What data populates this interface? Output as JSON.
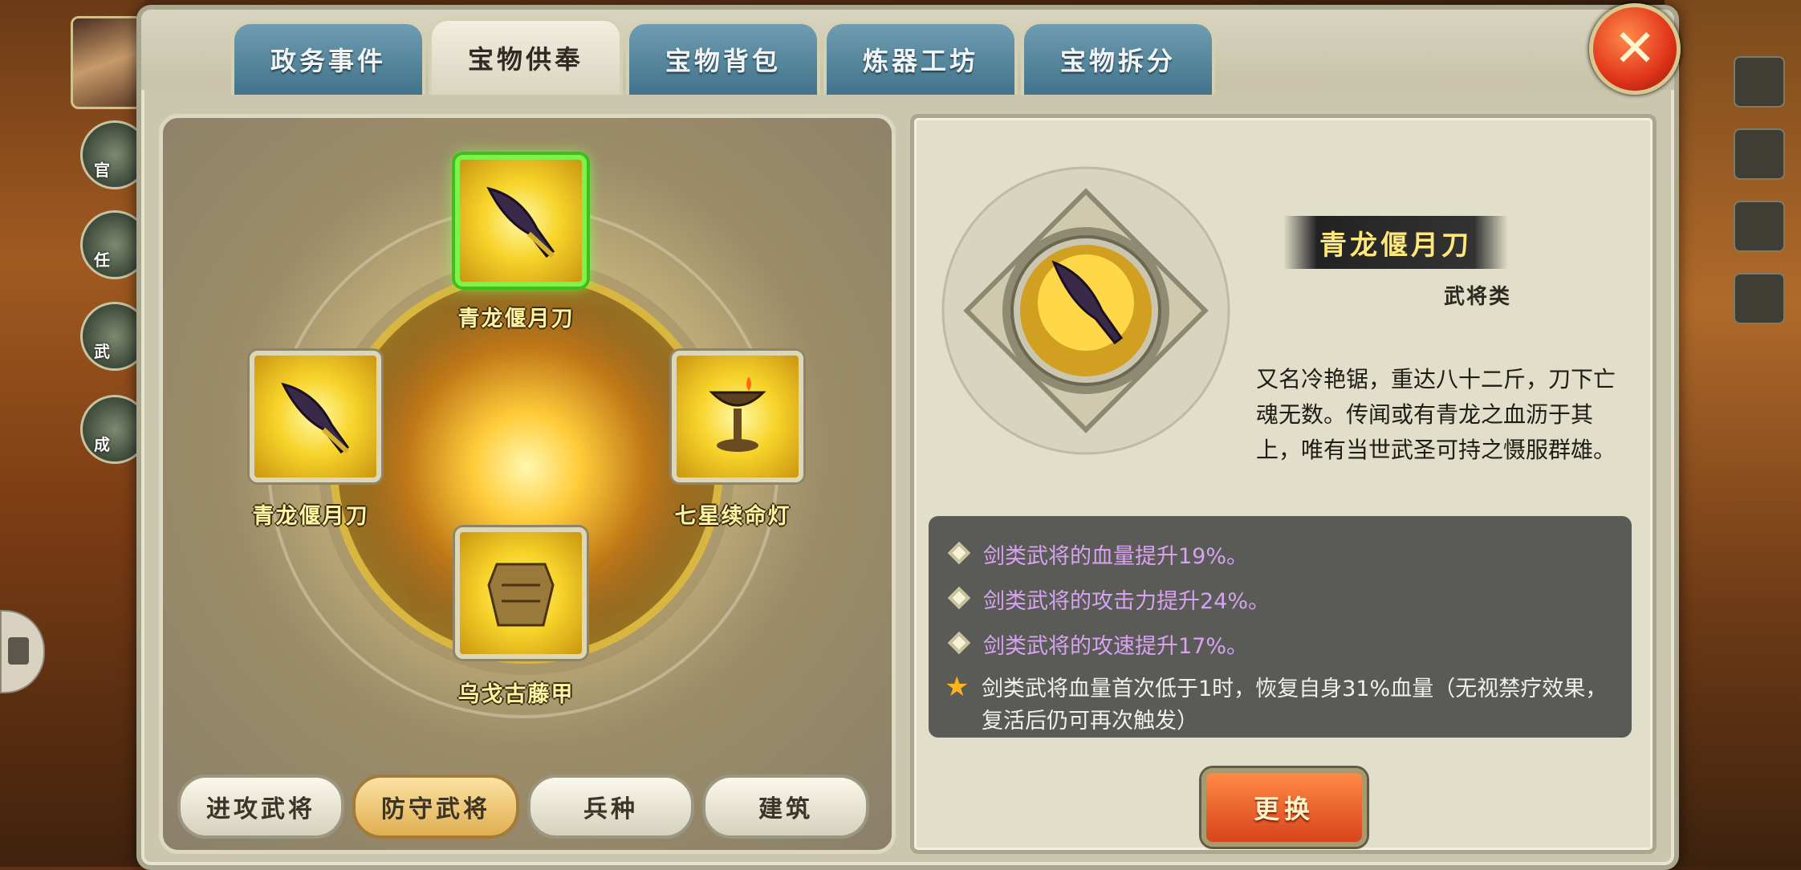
{
  "tabs": [
    {
      "label": "政务事件"
    },
    {
      "label": "宝物供奉"
    },
    {
      "label": "宝物背包"
    },
    {
      "label": "炼器工坊"
    },
    {
      "label": "宝物拆分"
    }
  ],
  "active_tab": "宝物供奉",
  "close_icon": "close-icon",
  "side_buttons": [
    "官",
    "任",
    "武",
    "成"
  ],
  "slots": {
    "top": {
      "name": "青龙偃月刀",
      "icon": "blade-icon",
      "selected": true
    },
    "left": {
      "name": "青龙偃月刀",
      "icon": "blade-icon"
    },
    "right": {
      "name": "七星续命灯",
      "icon": "lamp-icon"
    },
    "bottom": {
      "name": "乌戈古藤甲",
      "icon": "armor-icon"
    }
  },
  "categories": [
    {
      "label": "进攻武将"
    },
    {
      "label": "防守武将"
    },
    {
      "label": "兵种"
    },
    {
      "label": "建筑"
    }
  ],
  "active_category": "防守武将",
  "detail": {
    "name": "青龙偃月刀",
    "type": "武将类",
    "description": "又名冷艳锯，重达八十二斤，刀下亡魂无数。传闻或有青龙之血沥于其上，唯有当世武圣可持之慑服群雄。",
    "effects": [
      {
        "text": "剑类武将的血量提升19%。",
        "kind": "diamond"
      },
      {
        "text": "剑类武将的攻击力提升24%。",
        "kind": "diamond"
      },
      {
        "text": "剑类武将的攻速提升17%。",
        "kind": "diamond"
      },
      {
        "text": "剑类武将血量首次低于1时，恢复自身31%血量（无视禁疗效果，复活后仍可再次触发）",
        "kind": "star"
      }
    ],
    "swap_label": "更换"
  },
  "colors": {
    "accent_tab": "#42738a",
    "selected_slot": "#3fbd1a",
    "effect_purple": "#d7a3f0",
    "swap_button": "#d8431c"
  }
}
